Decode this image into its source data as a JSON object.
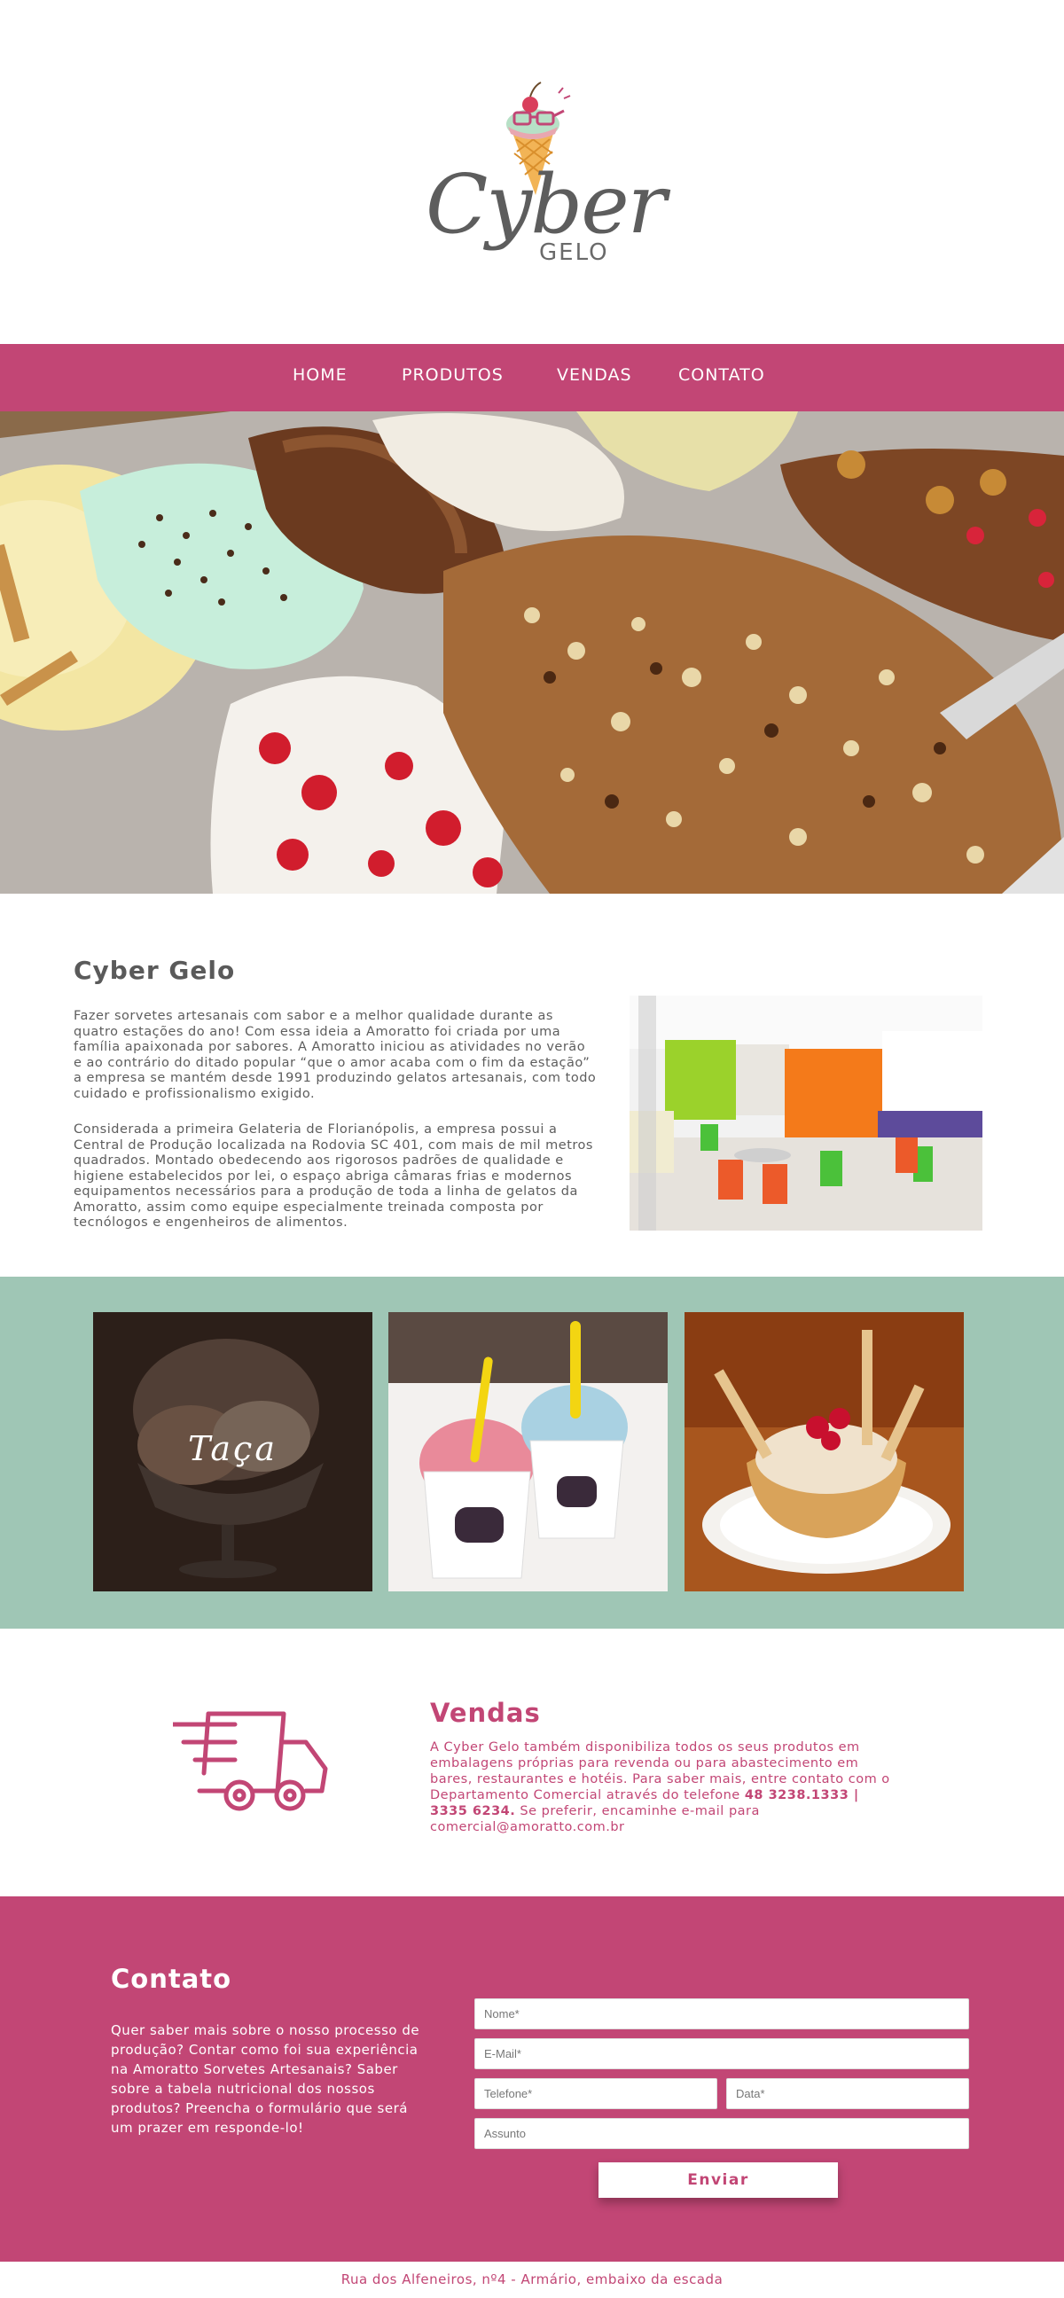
{
  "brand": {
    "name": "Cyber",
    "sub": "GELO"
  },
  "nav": {
    "items": [
      "HOME",
      "PRODUTOS",
      "VENDAS",
      "CONTATO"
    ]
  },
  "about": {
    "title": "Cyber Gelo",
    "paragraph1": "Fazer sorvetes artesanais com sabor e a melhor qualidade durante as quatro estações do ano! Com essa ideia a Amoratto foi criada por uma família apaixonada por sabores. A Amoratto iniciou as atividades no verão e ao contrário do ditado popular “que o amor acaba com o fim da estação” a empresa se mantém desde 1991 produzindo gelatos artesanais, com todo cuidado e profissionalismo exigido.",
    "paragraph2": "Considerada a primeira Gelateria de Florianópolis, a empresa possui a Central de Produção localizada na Rodovia SC 401, com mais de mil metros quadrados. Montado obedecendo aos rigorosos padrões de qualidade e higiene estabelecidos por lei, o espaço abriga câmaras frias e modernos equipamentos necessários para a produção de toda a linha de gelatos da Amoratto, assim como equipe especialmente treinada composta por tecnólogos e engenheiros de alimentos."
  },
  "gallery": {
    "caption": "Taça"
  },
  "vendas": {
    "title": "Vendas",
    "text1": "A Cyber Gelo também disponibiliza todos os seus produtos em embalagens próprias para revenda ou para abastecimento em bares, restaurantes e hotéis. Para saber mais, entre contato com o Departamento Comercial através do telefone",
    "phones": "48 3238.1333 | 3335 6234.",
    "text2": " Se preferir, encaminhe e-mail para comercial@amoratto.com.br"
  },
  "contato": {
    "title": "Contato",
    "text": "Quer saber mais sobre o nosso processo de produção? Contar como foi sua experiência na Amoratto Sorvetes Artesanais? Saber sobre a tabela nutricional dos nossos produtos? Preencha o formulário que será um prazer em responde-lo!",
    "placeholders": {
      "nome": "Nome*",
      "email": "E-Mail*",
      "telefone": "Telefone*",
      "data": "Data*",
      "assunto": "Assunto"
    },
    "submit_label": "Enviar"
  },
  "footer": {
    "address": "Rua dos Alfeneiros, nº4 - Armário, embaixo da escada"
  },
  "colors": {
    "brand_pink": "#c24675",
    "mint": "#9fc6b5",
    "text_gray": "#5d5d5d"
  }
}
